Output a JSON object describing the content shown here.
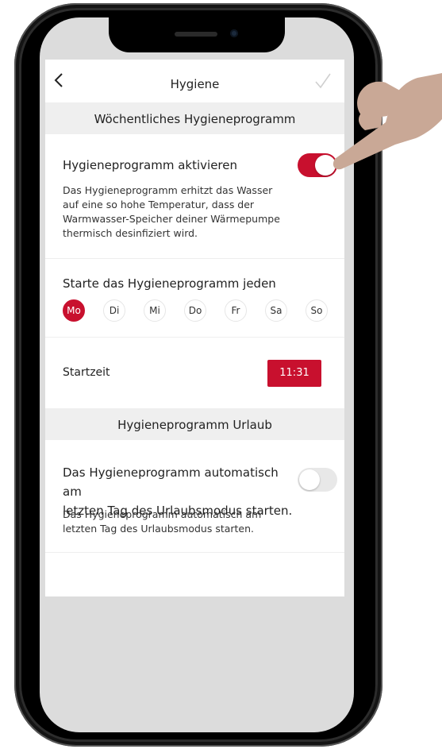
{
  "nav": {
    "title": "Hygiene"
  },
  "section_weekly": {
    "header": "Wöchentliches Hygieneprogramm",
    "activate_label": "Hygieneprogramm aktivieren",
    "activate_on": true,
    "description_lines": [
      "Das Hygieneprogramm erhitzt das Wasser",
      "auf eine so hohe Temperatur, dass der",
      "Warmwasser-Speicher deiner Wärmepumpe",
      "thermisch desinfiziert wird."
    ],
    "days_label": "Starte das Hygieneprogramm jeden",
    "days": [
      "Mo",
      "Di",
      "Mi",
      "Do",
      "Fr",
      "Sa",
      "So"
    ],
    "selected_day": "Mo",
    "starttime_label": "Startzeit",
    "starttime_value": "11:31"
  },
  "section_vacation": {
    "header": "Hygieneprogramm Urlaub",
    "label_lines": [
      "Das Hygieneprogramm automatisch am",
      "letzten Tag des Urlaubsmodus starten."
    ],
    "toggle_on": false,
    "description_lines": [
      "Das Hygieneprogramm automatisch am",
      "letzten Tag des Urlaubsmodus starten."
    ]
  },
  "colors": {
    "accent": "#c8102e",
    "section_bg": "#efefef",
    "toggle_off": "#e8e8e8",
    "hand": "#c9a896"
  },
  "icons": {
    "back": "chevron-left-icon",
    "confirm": "checkmark-icon"
  }
}
